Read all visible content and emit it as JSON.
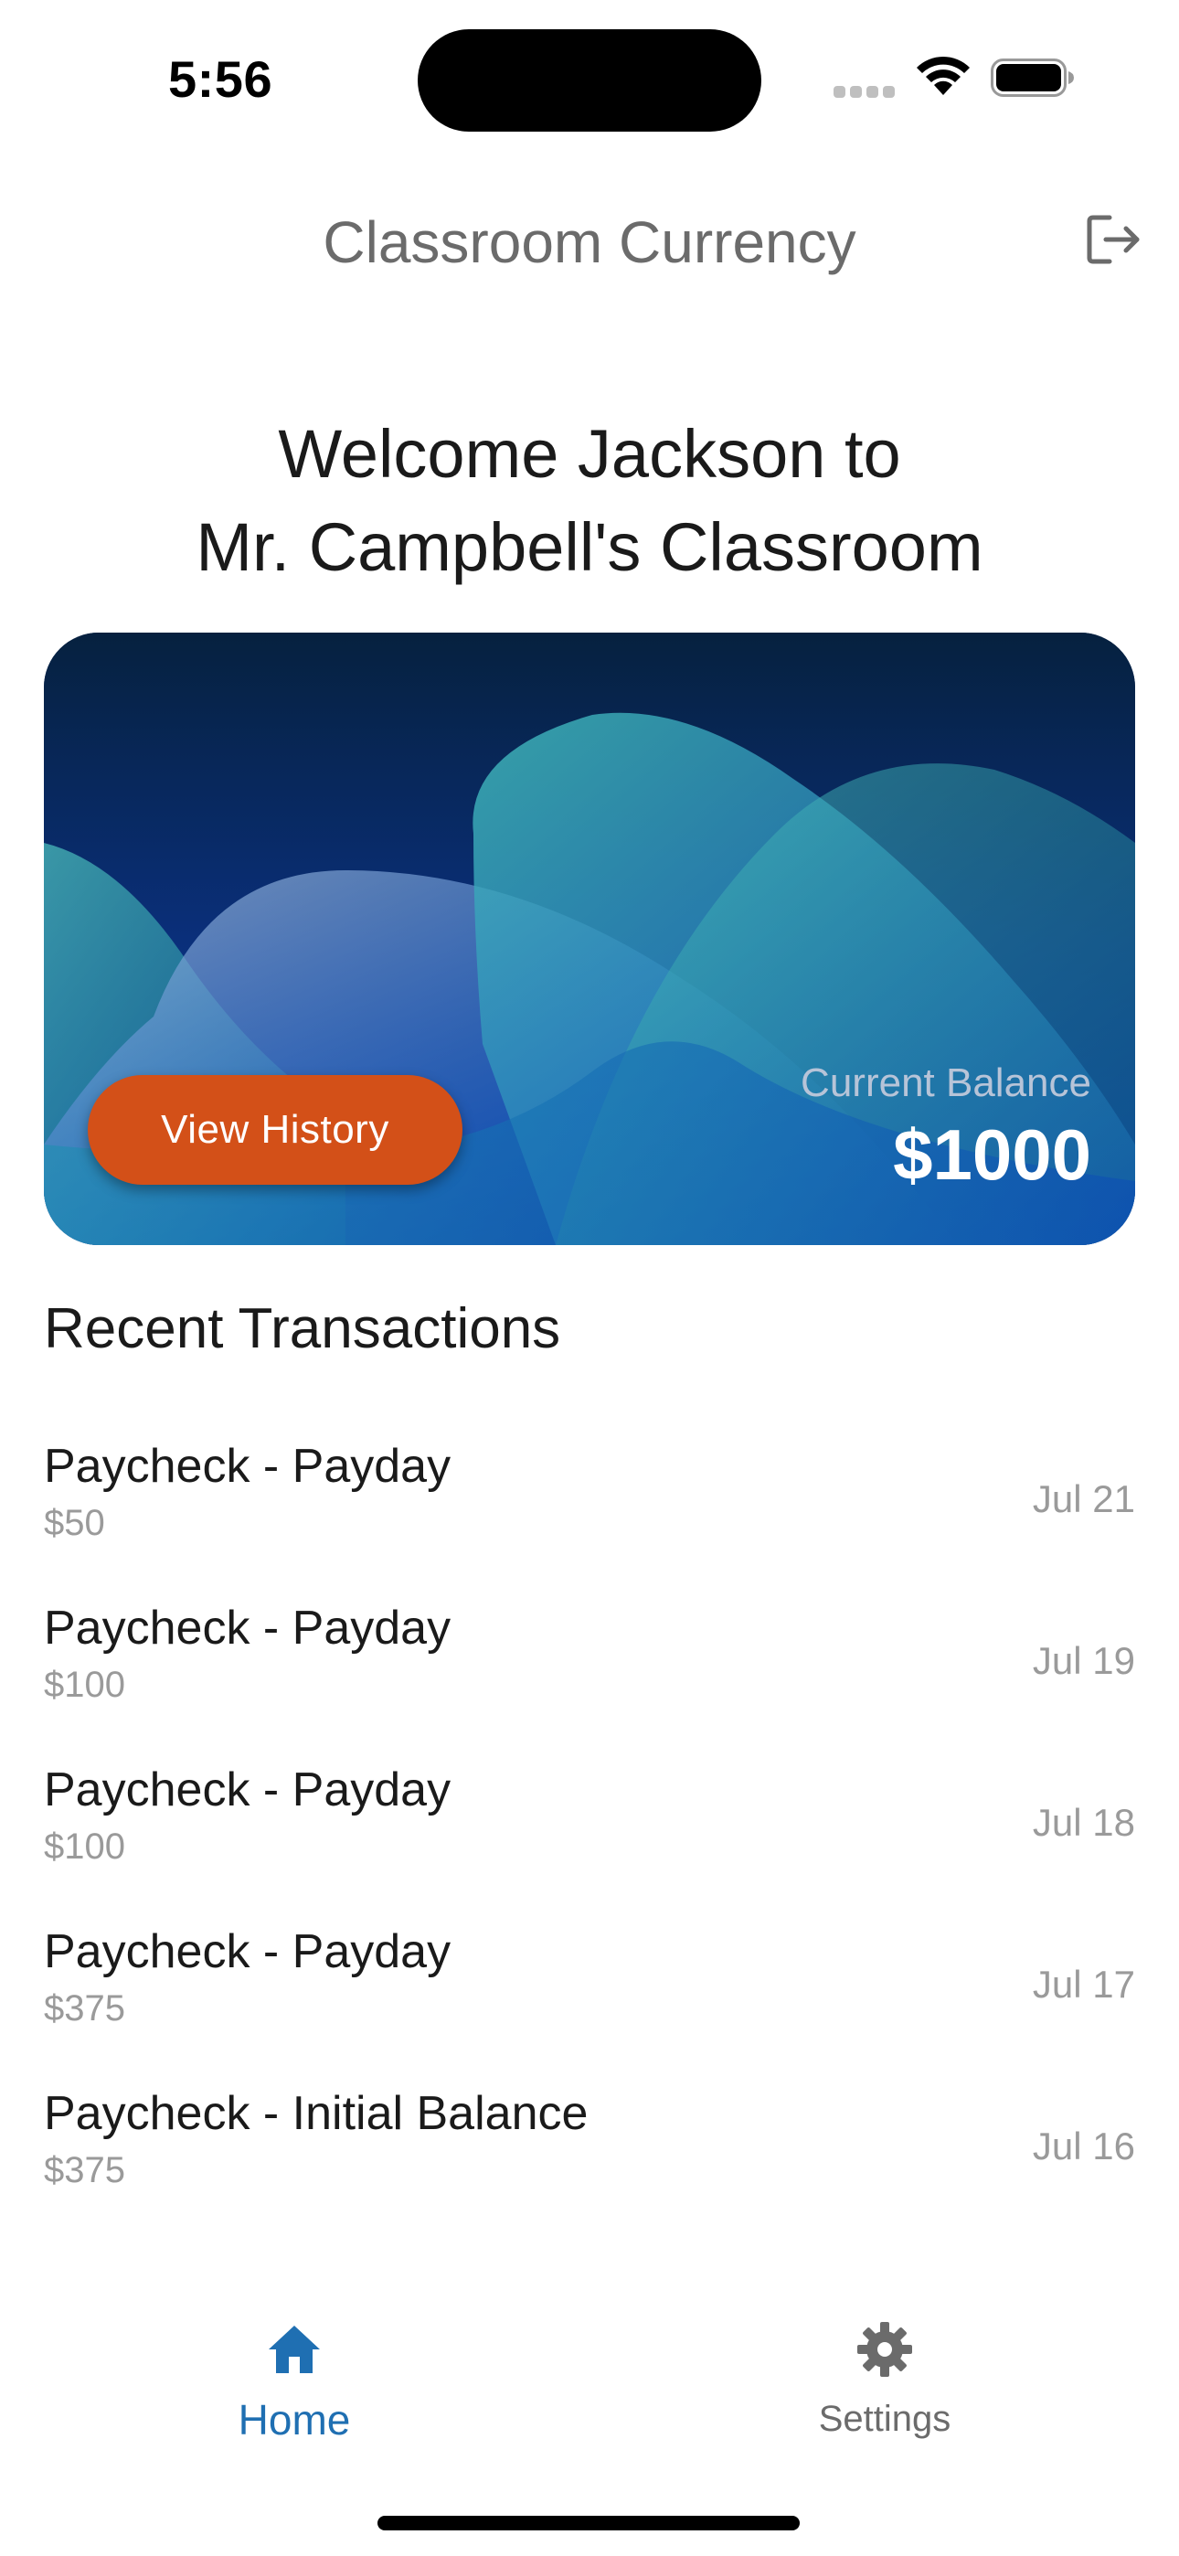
{
  "status_bar": {
    "time": "5:56"
  },
  "header": {
    "title": "Classroom Currency",
    "logout_icon": "logout-icon"
  },
  "welcome": {
    "line1": "Welcome Jackson to",
    "line2": "Mr. Campbell's Classroom"
  },
  "balance_card": {
    "view_history_label": "View History",
    "balance_label": "Current Balance",
    "balance_value": "$1000",
    "button_color": "#d35018"
  },
  "transactions": {
    "title": "Recent Transactions",
    "items": [
      {
        "title": "Paycheck - Payday",
        "amount": "$50",
        "date": "Jul 21"
      },
      {
        "title": "Paycheck - Payday",
        "amount": "$100",
        "date": "Jul 19"
      },
      {
        "title": "Paycheck - Payday",
        "amount": "$100",
        "date": "Jul 18"
      },
      {
        "title": "Paycheck - Payday",
        "amount": "$375",
        "date": "Jul 17"
      },
      {
        "title": "Paycheck - Initial Balance",
        "amount": "$375",
        "date": "Jul 16"
      }
    ]
  },
  "tab_bar": {
    "tabs": [
      {
        "label": "Home",
        "icon": "home-icon",
        "active": true,
        "color": "#1f6fb2"
      },
      {
        "label": "Settings",
        "icon": "gear-icon",
        "active": false,
        "color": "#6b6b6b"
      }
    ]
  }
}
